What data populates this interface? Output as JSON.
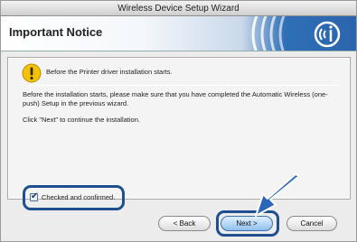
{
  "window": {
    "title": "Wireless Device Setup Wizard"
  },
  "header": {
    "title": "Important Notice"
  },
  "notice": {
    "text": "Before the Printer driver installation starts."
  },
  "body": {
    "paragraph1": "Before the installation starts, please make sure that you have completed the Automatic Wireless (one-push) Setup in the previous wizard.",
    "paragraph2": "Click \"Next\" to continue the installation."
  },
  "confirmation": {
    "label": "Checked and confirmed.",
    "checked": true
  },
  "buttons": {
    "back": "< Back",
    "next": "Next >",
    "cancel": "Cancel"
  },
  "icons": {
    "warning": "warning-icon",
    "wireless_logo": "wireless-logo-icon",
    "pointer_arrow": "arrow-icon"
  },
  "colors": {
    "highlight": "#1f4f8f",
    "header_accent": "#2f6fb6"
  }
}
